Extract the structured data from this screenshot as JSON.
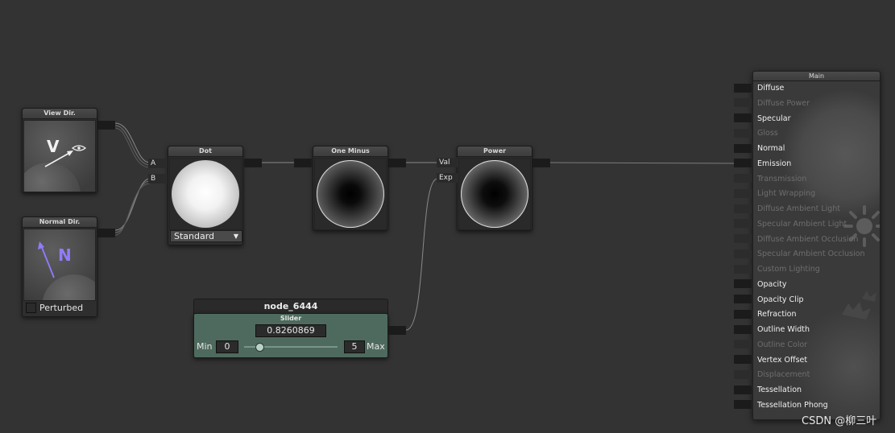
{
  "nodes": {
    "view_dir": {
      "title": "View Dir.",
      "glyph": "V"
    },
    "normal_dir": {
      "title": "Normal Dir.",
      "glyph": "N",
      "perturbed_label": "Perturbed",
      "perturbed_checked": false
    },
    "dot": {
      "title": "Dot",
      "port_a": "A",
      "port_b": "B",
      "mode": "Standard"
    },
    "one_minus": {
      "title": "One Minus"
    },
    "power": {
      "title": "Power",
      "port_val": "Val",
      "port_exp": "Exp"
    },
    "slider": {
      "name": "node_6444",
      "title": "Slider",
      "value": "0.8260869",
      "min_label": "Min",
      "min": "0",
      "max": "5",
      "max_label": "Max",
      "fraction": 0.165
    }
  },
  "main": {
    "title": "Main",
    "inputs": [
      {
        "label": "Diffuse",
        "enabled": true
      },
      {
        "label": "Diffuse Power",
        "enabled": false
      },
      {
        "label": "Specular",
        "enabled": true
      },
      {
        "label": "Gloss",
        "enabled": false
      },
      {
        "label": "Normal",
        "enabled": true
      },
      {
        "label": "Emission",
        "enabled": true
      },
      {
        "label": "Transmission",
        "enabled": false
      },
      {
        "label": "Light Wrapping",
        "enabled": false
      },
      {
        "label": "Diffuse Ambient Light",
        "enabled": false
      },
      {
        "label": "Specular Ambient Light",
        "enabled": false
      },
      {
        "label": "Diffuse Ambient Occlusion",
        "enabled": false
      },
      {
        "label": "Specular Ambient Occlusion",
        "enabled": false
      },
      {
        "label": "Custom Lighting",
        "enabled": false
      },
      {
        "label": "Opacity",
        "enabled": true
      },
      {
        "label": "Opacity Clip",
        "enabled": true
      },
      {
        "label": "Refraction",
        "enabled": true
      },
      {
        "label": "Outline Width",
        "enabled": true
      },
      {
        "label": "Outline Color",
        "enabled": false
      },
      {
        "label": "Vertex Offset",
        "enabled": true
      },
      {
        "label": "Displacement",
        "enabled": false
      },
      {
        "label": "Tessellation",
        "enabled": true
      },
      {
        "label": "Tessellation Phong",
        "enabled": true
      }
    ]
  },
  "watermark": "CSDN @柳三叶",
  "colors": {
    "canvas": "#333333",
    "slider_node": "#4e6a5e",
    "wire": "#9a9a9a"
  }
}
